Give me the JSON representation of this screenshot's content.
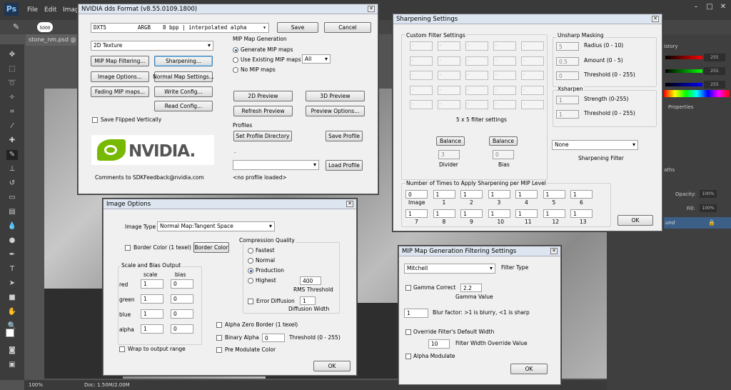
{
  "ps": {
    "logo": "Ps",
    "menu": [
      "File",
      "Edit",
      "Imag"
    ],
    "window_controls": [
      "–",
      "□",
      "✕"
    ],
    "brush_size": "5000",
    "doc_tab": "stone_nm.psd @ 1",
    "status_zoom": "100%",
    "status_doc": "Doc: 1.50M/2.00M",
    "right_tabs": {
      "history": "istory",
      "properties": "Properties",
      "paths": "aths"
    },
    "color_values": [
      "255",
      "255",
      "255"
    ],
    "layers": {
      "opacity_label": "Opacity:",
      "opacity_value": "100%",
      "fill_label": "Fill:",
      "fill_value": "100%",
      "layer_name": "und"
    },
    "colors": {
      "accent": "#1e3652",
      "logo_text": "#8fc7ff"
    }
  },
  "dds": {
    "title": "NVIDIA dds Format (v8.55.0109.1800)",
    "format": {
      "name": "DXT5",
      "type": "ARGB",
      "bpp": "8 bpp | interpolated alpha"
    },
    "save_label": "Save",
    "cancel_label": "Cancel",
    "texture_type": "2D Texture",
    "buttons": {
      "mip_filter": "MIP Map Filtering...",
      "sharpening": "Sharpening...",
      "image_options": "Image Options...",
      "normal_map": "Normal Map Settings...",
      "fading_mip": "Fading MIP maps...",
      "write_config": "Write Config...",
      "read_config": "Read Config..."
    },
    "save_flipped": "Save Flipped Vertically",
    "logo_text": "NVIDIA.",
    "logo_color": "#76b900",
    "feedback": "Comments to SDKFeedback@nvidia.com",
    "mip_gen": {
      "title": "MIP Map Generation",
      "generate": "Generate MIP maps",
      "use_existing": "Use Existing MIP maps",
      "none": "No MIP maps",
      "count": "All"
    },
    "preview": {
      "p2d": "2D Preview",
      "p3d": "3D Preview",
      "refresh": "Refresh Preview",
      "options": "Preview Options..."
    },
    "profiles": {
      "title": "Profiles",
      "set_dir": "Set Profile Directory",
      "save": "Save Profile",
      "dot": ".",
      "load": "Load Profile",
      "status": "<no profile loaded>"
    }
  },
  "sharp": {
    "title": "Sharpening Settings",
    "custom_title": "Custom Filter Settings",
    "cell_value": "-",
    "grid_caption": "5 x 5 filter settings",
    "balance": "Balance",
    "divider": {
      "value": "3",
      "label": "Divider"
    },
    "bias": {
      "value": "0",
      "label": "Bias"
    },
    "unsharp": {
      "title": "Unsharp Masking",
      "radius": {
        "value": "5",
        "label": "Radius (0 - 10)"
      },
      "amount": {
        "value": "0.5",
        "label": "Amount (0 - 5)"
      },
      "threshold": {
        "value": "0",
        "label": "Threshold (0 - 255)"
      }
    },
    "xsharpen": {
      "title": "Xsharpen",
      "strength": {
        "value": "1",
        "label": "Strength (0-255)"
      },
      "threshold": {
        "value": "1",
        "label": "Threshold (0 - 255)"
      }
    },
    "filter": {
      "value": "None",
      "label": "Sharpening Filter"
    },
    "times": {
      "title": "Number of Times to Apply Sharpening per MIP Level",
      "row1": [
        {
          "v": "0",
          "l": "Image"
        },
        {
          "v": "1",
          "l": "1"
        },
        {
          "v": "1",
          "l": "2"
        },
        {
          "v": "1",
          "l": "3"
        },
        {
          "v": "1",
          "l": "4"
        },
        {
          "v": "1",
          "l": "5"
        },
        {
          "v": "1",
          "l": "6"
        }
      ],
      "row2": [
        {
          "v": "1",
          "l": "7"
        },
        {
          "v": "1",
          "l": "8"
        },
        {
          "v": "1",
          "l": "9"
        },
        {
          "v": "1",
          "l": "10"
        },
        {
          "v": "1",
          "l": "11"
        },
        {
          "v": "1",
          "l": "12"
        },
        {
          "v": "1",
          "l": "13"
        }
      ]
    },
    "ok": "OK"
  },
  "imgopt": {
    "title": "Image Options",
    "image_type_label": "Image Type",
    "image_type": "Normal Map:Tangent Space",
    "border_color_label": "Border Color (1 texel)",
    "border_color_btn": "Border Color",
    "scale_bias": {
      "title": "Scale and Bias Output",
      "col_scale": "scale",
      "col_bias": "bias",
      "rows": [
        {
          "label": "red",
          "scale": "1",
          "bias": "0"
        },
        {
          "label": "green",
          "scale": "1",
          "bias": "0"
        },
        {
          "label": "blue",
          "scale": "1",
          "bias": "0"
        },
        {
          "label": "alpha",
          "scale": "1",
          "bias": "0"
        }
      ]
    },
    "wrap": "Wrap to output range",
    "compression": {
      "title": "Compression Quality",
      "fastest": "Fastest",
      "normal": "Normal",
      "production": "Production",
      "highest": "Highest",
      "rms_value": "400",
      "rms_label": "RMS Threshold",
      "error_diff": "Error Diffusion",
      "diff_width_value": "1",
      "diff_width_label": "Diffusion Width"
    },
    "alpha_zero": "Alpha Zero Border (1 texel)",
    "binary_alpha": "Binary Alpha",
    "binary_value": "0",
    "binary_threshold": "Threshold (0 - 255)",
    "pre_mod": "Pre Modulate Color",
    "ok": "OK"
  },
  "mipf": {
    "title": "MIP Map Generation Filtering Settings",
    "filter_value": "Mitchell",
    "filter_label": "Filter Type",
    "gamma_label": "Gamma Correct",
    "gamma_value": "2.2",
    "gamma_value_label": "Gamma Value",
    "blur_value": "1",
    "blur_label": "Blur factor: >1 is blurry, <1 is sharp",
    "override_label": "Override Filter's Default Width",
    "width_value": "10",
    "width_label": "Filter Width Override Value",
    "alpha_mod": "Alpha Modulate",
    "ok": "OK"
  }
}
